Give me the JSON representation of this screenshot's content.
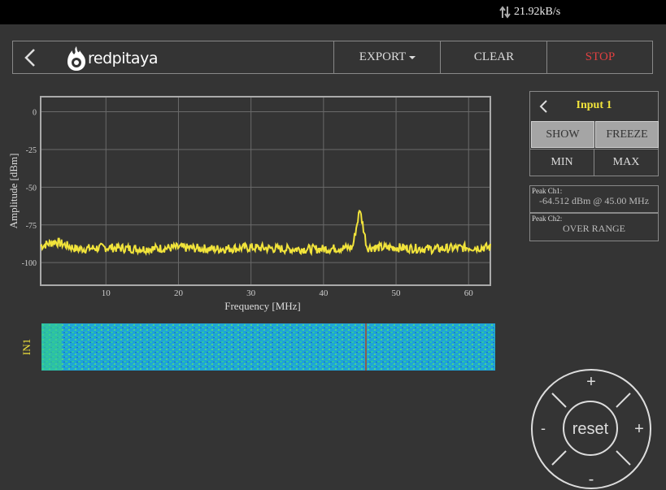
{
  "status": {
    "speed": "21.92kB/s"
  },
  "nav": {
    "logo_text": "redpitaya",
    "export_label": "EXPORT",
    "clear_label": "CLEAR",
    "stop_label": "STOP"
  },
  "panel": {
    "title": "Input 1",
    "show": "SHOW",
    "freeze": "FREEZE",
    "min": "MIN",
    "max": "MAX"
  },
  "peaks": [
    {
      "label": "Peak  Ch1:",
      "value": "-64.512  dBm @ 45.00  MHz"
    },
    {
      "label": "Peak  Ch2:",
      "value": "OVER RANGE"
    }
  ],
  "waterfall": {
    "label": "IN1"
  },
  "controls": {
    "reset": "reset",
    "up": "+",
    "down": "-",
    "left": "-",
    "right": "+"
  },
  "colors": {
    "trace": "#f1e33b",
    "stop": "#e04040",
    "accent": "#f1e33b"
  },
  "chart_data": {
    "type": "line",
    "xlabel": "Frequency   [MHz]",
    "ylabel": "Amplitude  [dBm]",
    "xlim": [
      1,
      63
    ],
    "ylim": [
      -115,
      10
    ],
    "xticks": [
      10,
      20,
      30,
      40,
      50,
      60
    ],
    "yticks": [
      0,
      -25,
      -50,
      -75,
      -100
    ],
    "grid": true,
    "series": [
      {
        "x": [
          1,
          3,
          6,
          10,
          15,
          20,
          25,
          30,
          35,
          40,
          44,
          45,
          46,
          50,
          55,
          60,
          63
        ],
        "y": [
          -89,
          -86,
          -91,
          -90,
          -91,
          -90,
          -91,
          -90,
          -91,
          -91,
          -90,
          -64.5,
          -90,
          -90,
          -91,
          -90,
          -90
        ]
      }
    ]
  }
}
